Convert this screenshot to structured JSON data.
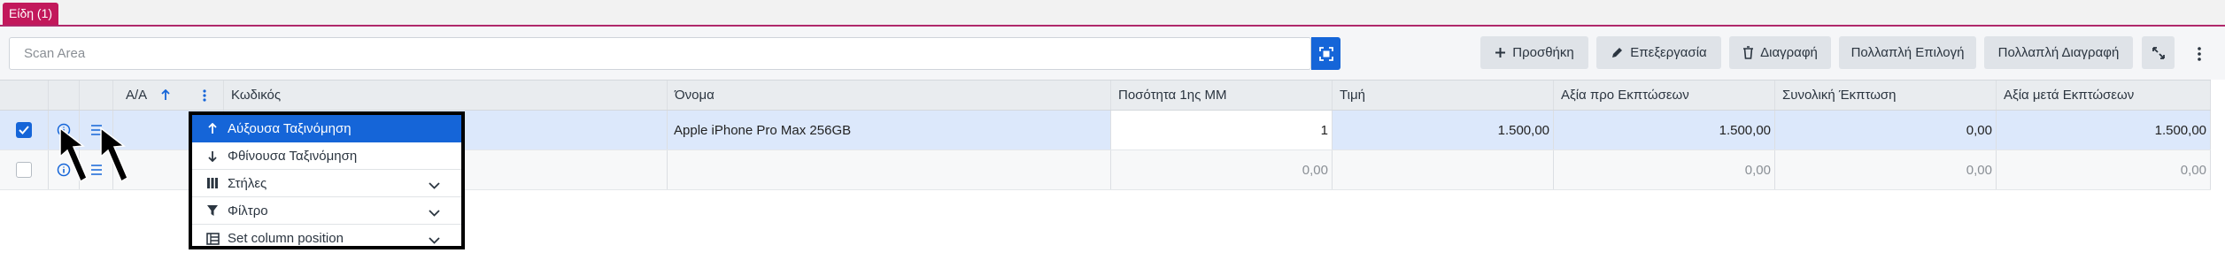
{
  "tab": {
    "label": "Είδη (1)"
  },
  "toolbar": {
    "scan_placeholder": "Scan Area",
    "add_label": "Προσθήκη",
    "edit_label": "Επεξεργασία",
    "delete_label": "Διαγραφή",
    "multi_select_label": "Πολλαπλή Επιλογή",
    "multi_delete_label": "Πολλαπλή Διαγραφή"
  },
  "grid": {
    "headers": {
      "aa": "Α/Α",
      "code": "Κωδικός",
      "name": "Όνομα",
      "qty": "Ποσότητα 1ης ΜΜ",
      "price": "Τιμή",
      "value_before": "Αξία προ Εκπτώσεων",
      "total_discount": "Συνολική Έκπτωση",
      "value_after": "Αξία μετά Εκπτώσεων"
    },
    "rows": [
      {
        "name": "Apple iPhone Pro Max 256GB",
        "qty": "1",
        "price": "1.500,00",
        "value_before": "1.500,00",
        "total_discount": "0,00",
        "value_after": "1.500,00"
      },
      {
        "name": "",
        "qty": "0,00",
        "price": "",
        "value_before": "0,00",
        "total_discount": "0,00",
        "value_after": "0,00"
      }
    ]
  },
  "column_menu": {
    "sort_asc": "Αύξουσα Ταξινόμηση",
    "sort_desc": "Φθίνουσα Ταξινόμηση",
    "columns": "Στήλες",
    "filter": "Φίλτρο",
    "set_position": "Set column position"
  },
  "colors": {
    "tab": "#c2185b",
    "accent": "#1565d8",
    "toolbar_button": "#dfe3e8"
  }
}
